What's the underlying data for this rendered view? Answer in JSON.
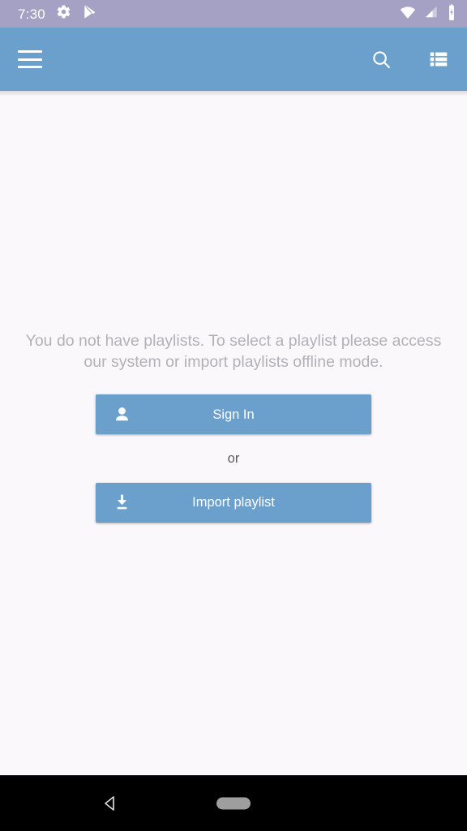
{
  "status_bar": {
    "clock": "7:30",
    "left_icons": [
      {
        "name": "settings-gear-icon",
        "label": "Settings"
      },
      {
        "name": "play-store-icon",
        "label": "Google Play"
      }
    ],
    "right_icons": [
      {
        "name": "wifi-icon",
        "label": "Wi-Fi signal full"
      },
      {
        "name": "cellular-signal-icon",
        "label": "Cellular signal"
      },
      {
        "name": "battery-charging-icon",
        "label": "Battery charging"
      }
    ],
    "background_color": "#a5a1c4"
  },
  "app_bar": {
    "title": "",
    "menu_label": "Open navigation drawer",
    "search_label": "Search",
    "view_list_label": "View list",
    "background_color": "#6aa0cb"
  },
  "main": {
    "empty_state_message": "You do not have playlists. To select a playlist please access our system or import playlists offline mode.",
    "sign_in_label": "Sign In",
    "divider_label": "or",
    "import_playlist_label": "Import playlist",
    "button_color": "#6aa0cb",
    "background_color": "#faf8fb",
    "message_color": "#b3b1b5"
  },
  "nav_bar": {
    "back_label": "Back",
    "home_label": "Home",
    "background_color": "#000000"
  }
}
